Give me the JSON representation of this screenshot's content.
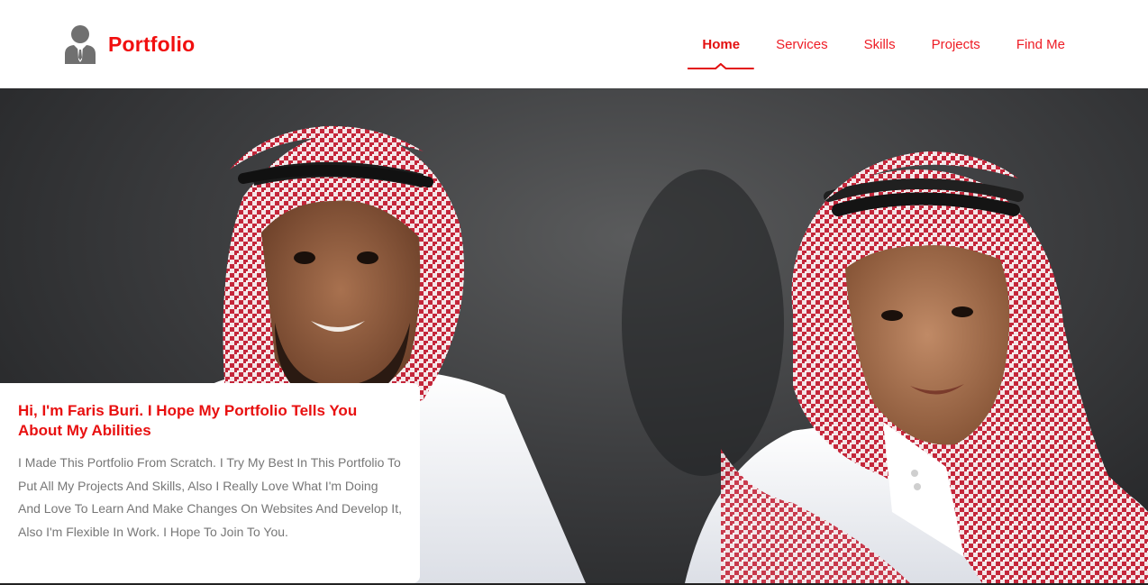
{
  "brand": {
    "logo_icon": "user-avatar-icon",
    "title": "Portfolio",
    "accent_color": "#f10f0f"
  },
  "nav": {
    "items": [
      {
        "label": "Home",
        "active": true
      },
      {
        "label": "Services",
        "active": false
      },
      {
        "label": "Skills",
        "active": false
      },
      {
        "label": "Projects",
        "active": false
      },
      {
        "label": "Find Me",
        "active": false
      }
    ]
  },
  "hero": {
    "image_subject": "two-people-portrait-photo"
  },
  "intro": {
    "title": "Hi, I'm Faris Buri. I Hope My Portfolio Tells You About My Abilities",
    "text": "I Made This Portfolio From Scratch. I Try My Best In This Portfolio To Put All My Projects And Skills, Also I Really Love What I'm Doing And Love To Learn And Make Changes On Websites And Develop It, Also I'm Flexible In Work. I Hope To Join To You."
  }
}
